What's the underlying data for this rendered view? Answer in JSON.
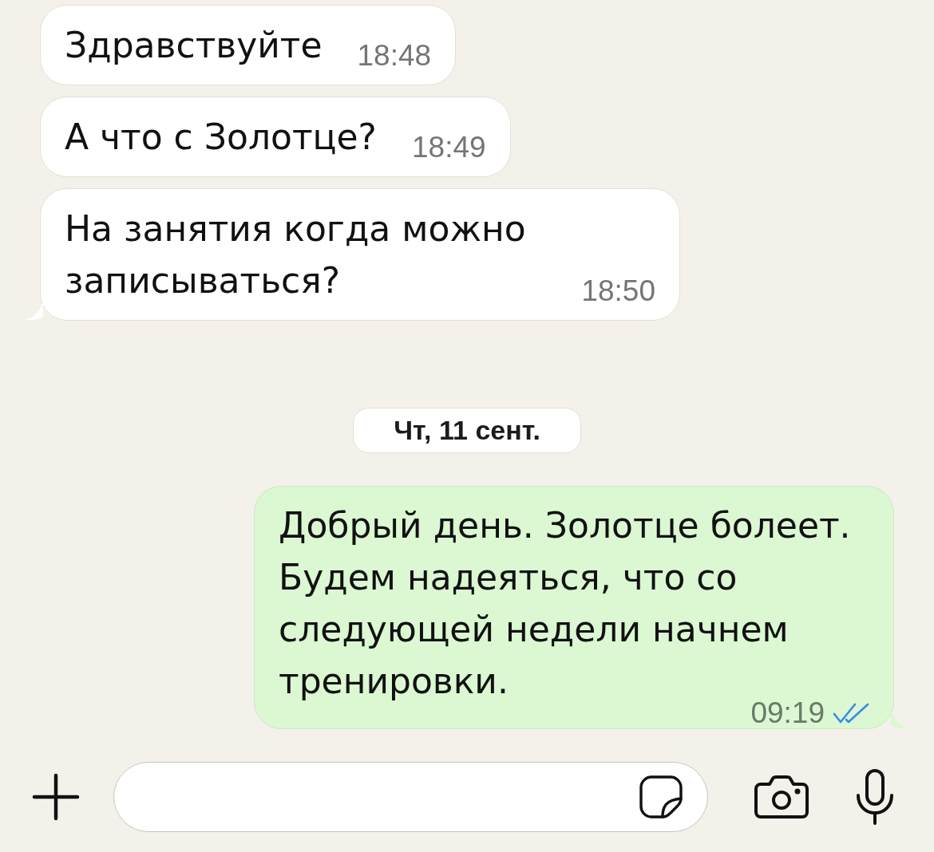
{
  "messages": [
    {
      "kind": "incoming",
      "text": "Здравствуйте",
      "time": "18:48",
      "tail": false
    },
    {
      "kind": "incoming",
      "text": "А что с Золотце?",
      "time": "18:49",
      "tail": false
    },
    {
      "kind": "incoming",
      "text": "На занятия когда можно записываться?",
      "time": "18:50",
      "tail": true
    },
    {
      "kind": "date",
      "text": "Чт, 11 сент."
    },
    {
      "kind": "outgoing",
      "text": "Добрый день. Золотце болеет. Будем надеяться, что со следующей недели начнем тренировки.",
      "time": "09:19",
      "tail": true,
      "read": true
    }
  ]
}
